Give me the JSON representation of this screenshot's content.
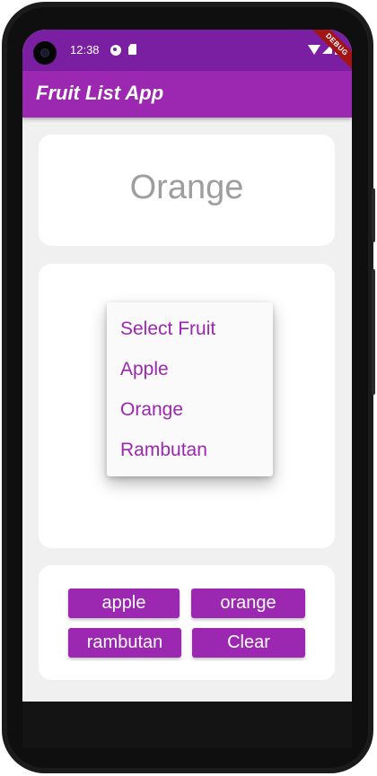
{
  "status_bar": {
    "time": "12:38",
    "debug_banner": "DEBUG",
    "icons": [
      "camera-icon",
      "sync-icon",
      "sd-card-icon",
      "wifi-icon",
      "signal-icon",
      "battery-icon"
    ]
  },
  "app_bar": {
    "title": "Fruit List App"
  },
  "display": {
    "selected_fruit": "Orange"
  },
  "menu": {
    "items": [
      "Select Fruit",
      "Apple",
      "Orange",
      "Rambutan"
    ]
  },
  "buttons": {
    "apple": "apple",
    "orange": "orange",
    "rambutan": "rambutan",
    "clear": "Clear"
  },
  "colors": {
    "primary": "#9c27b0",
    "primary_dark": "#7b1fa2",
    "background": "#f0f0f0",
    "display_text": "#9e9e9e"
  }
}
